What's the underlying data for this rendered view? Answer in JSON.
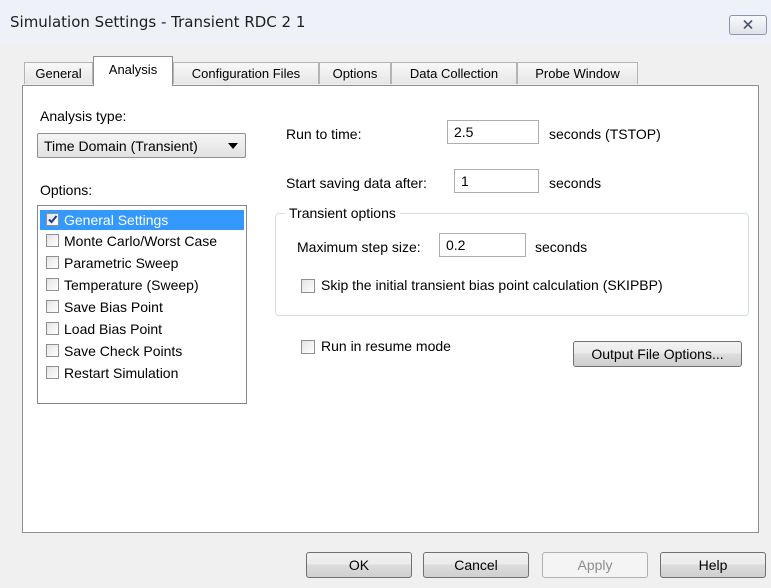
{
  "window": {
    "title": "Simulation Settings - Transient RDC 2 1"
  },
  "tabs": [
    {
      "label": "General"
    },
    {
      "label": "Analysis"
    },
    {
      "label": "Configuration Files"
    },
    {
      "label": "Options"
    },
    {
      "label": "Data Collection"
    },
    {
      "label": "Probe Window"
    }
  ],
  "analysis": {
    "type_label": "Analysis type:",
    "type_value": "Time Domain (Transient)",
    "options_label": "Options:",
    "options": [
      {
        "label": "General Settings",
        "checked": true,
        "selected": true
      },
      {
        "label": "Monte Carlo/Worst Case",
        "checked": false
      },
      {
        "label": "Parametric Sweep",
        "checked": false
      },
      {
        "label": "Temperature (Sweep)",
        "checked": false
      },
      {
        "label": "Save Bias Point",
        "checked": false
      },
      {
        "label": "Load Bias Point",
        "checked": false
      },
      {
        "label": "Save Check Points",
        "checked": false
      },
      {
        "label": "Restart Simulation",
        "checked": false
      }
    ]
  },
  "run_to_time": {
    "label": "Run to time:",
    "value": "2.5",
    "unit": "seconds  (TSTOP)"
  },
  "start_saving": {
    "label": "Start saving data after:",
    "value": "1",
    "unit": "seconds"
  },
  "transient_options": {
    "title": "Transient options",
    "max_step_label": "Maximum step size:",
    "max_step_value": "0.2",
    "max_step_unit": "seconds",
    "skip_bias_label": "Skip the initial transient bias point calculation  (SKIPBP)",
    "skip_bias_checked": false
  },
  "resume_mode": {
    "label": "Run in resume mode",
    "checked": false
  },
  "buttons": {
    "output_file_options": "Output File Options...",
    "ok": "OK",
    "cancel": "Cancel",
    "apply": "Apply",
    "help": "Help"
  }
}
